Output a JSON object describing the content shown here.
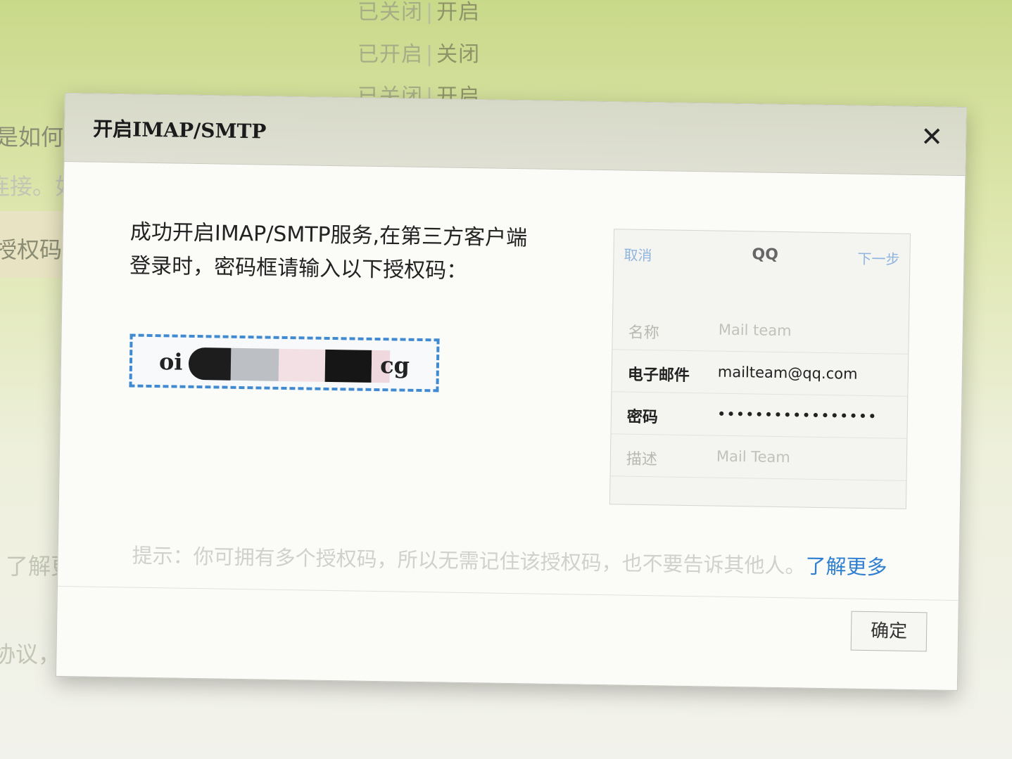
{
  "background": {
    "status_rows": [
      {
        "state": "已关闭",
        "action": "开启"
      },
      {
        "state": "已开启",
        "action": "关闭"
      },
      {
        "state": "已关闭",
        "action": "开启"
      }
    ],
    "left_fragments": [
      "是如何",
      "连接。如",
      "授权码",
      "了解更",
      "协议，"
    ]
  },
  "dialog": {
    "title": "开启IMAP/SMTP",
    "close_glyph": "✕",
    "message_line1": "成功开启IMAP/SMTP服务,在第三方客户端",
    "message_line2": "登录时，密码框请输入以下授权码：",
    "auth_code_start": "oi",
    "auth_code_end": "cg",
    "illustration": {
      "cancel": "取消",
      "title": "QQ",
      "next": "下一步",
      "fields": [
        {
          "label": "名称",
          "value": "Mail team"
        },
        {
          "label": "电子邮件",
          "value": "mailteam@qq.com"
        },
        {
          "label": "密码",
          "value": "•••••••••••••••••"
        },
        {
          "label": "描述",
          "value": "Mail Team"
        }
      ]
    },
    "hint": "提示：你可拥有多个授权码，所以无需记住该授权码，也不要告诉其他人。",
    "learn_more": "了解更多",
    "ok_button": "确定"
  }
}
